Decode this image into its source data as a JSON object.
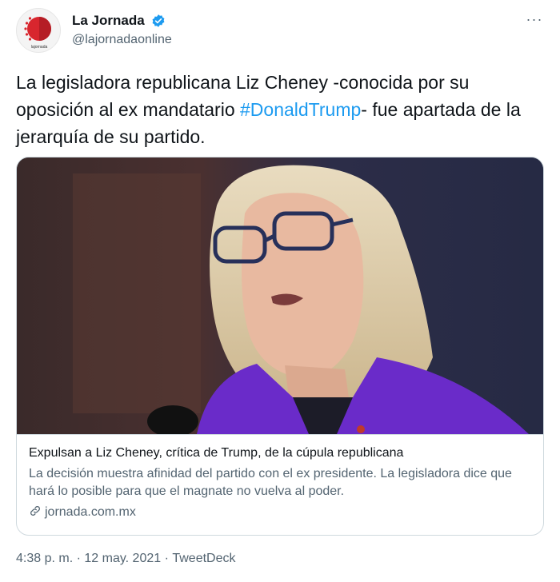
{
  "account": {
    "display_name": "La Jornada",
    "handle": "@lajornadaonline",
    "avatar_caption": "lajornada",
    "verified_icon": "verified-badge-icon",
    "verified_color": "#1d9bf0"
  },
  "menu": {
    "more_label": "···"
  },
  "tweet": {
    "text_before": "La legisladora republicana Liz Cheney -conocida por su oposición al ex mandatario ",
    "hashtag": "#DonaldTrump",
    "text_after": "- fue apartada de la jerarquía de su partido."
  },
  "card": {
    "image_description": "",
    "title": "Expulsan a Liz Cheney, crítica de Trump, de la cúpula republicana",
    "description": "La decisión muestra afinidad del partido con el ex presidente. La legisladora dice que hará lo posible para que el magnate no vuelva al poder.",
    "domain": "jornada.com.mx",
    "domain_icon": "link-icon"
  },
  "meta": {
    "time": "4:38 p. m.",
    "date": "12 may. 2021",
    "source": "TweetDeck",
    "separator": " · "
  },
  "colors": {
    "text": "#0f1419",
    "secondary": "#536471",
    "link": "#1d9bf0",
    "border": "#cfd9de",
    "brand_red": "#d8262e",
    "jacket_purple": "#6a2bc9"
  }
}
